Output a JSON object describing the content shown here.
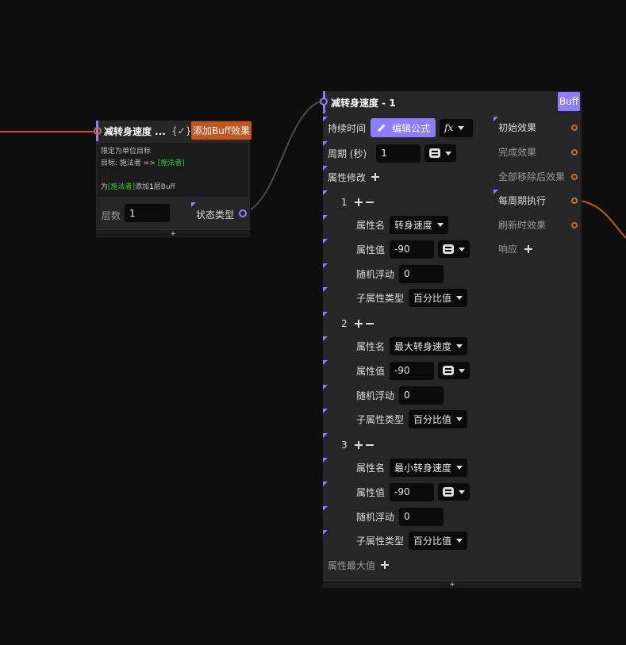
{
  "node_left": {
    "title": "减转身速度 ...",
    "check_label": "{✓}",
    "action_button": "添加Buff效果",
    "desc": {
      "line1": "限定为单位目标",
      "line2_prefix": "目标: 施法者 => ",
      "line2_link": "[施法者]",
      "line4_prefix": "为",
      "line4_link": "[施法者]",
      "line4_mid": "添加",
      "line4_count": "1",
      "line4_suffix": "层Buff"
    },
    "layers_label": "层数",
    "layers_value": "1",
    "state_type_label": "状态类型",
    "footer_plus": "+"
  },
  "node_main": {
    "title": "减转身速度 - 1",
    "badge": "Buff",
    "duration_label": "持续时间",
    "edit_formula_button": "编辑公式",
    "fx_icon": "fx",
    "period_label": "周期 (秒)",
    "period_value": "1",
    "attr_mod_label": "属性修改",
    "groups": [
      {
        "index": "1",
        "attr_name_label": "属性名",
        "attr_name_value": "转身速度",
        "attr_value_label": "属性值",
        "attr_value": "-90",
        "float_label": "随机浮动",
        "float_value": "0",
        "subtype_label": "子属性类型",
        "subtype_value": "百分比值"
      },
      {
        "index": "2",
        "attr_name_label": "属性名",
        "attr_name_value": "最大转身速度",
        "attr_value_label": "属性值",
        "attr_value": "-90",
        "float_label": "随机浮动",
        "float_value": "0",
        "subtype_label": "子属性类型",
        "subtype_value": "百分比值"
      },
      {
        "index": "3",
        "attr_name_label": "属性名",
        "attr_name_value": "最小转身速度",
        "attr_value_label": "属性值",
        "attr_value": "-90",
        "float_label": "随机浮动",
        "float_value": "0",
        "subtype_label": "子属性类型",
        "subtype_value": "百分比值"
      }
    ],
    "attr_max_label": "属性最大值",
    "outputs": {
      "initial": "初始效果",
      "complete": "完成效果",
      "after_remove_all": "全部移除后效果",
      "each_period": "每周期执行",
      "on_refresh": "刷新时效果",
      "response": "响应"
    },
    "footer_plus": "+"
  },
  "colors": {
    "accent": "#8e7cff",
    "orange_button": "#c4551f",
    "port_orange": "#d06a33",
    "link_green": "#2ecc40",
    "wire_gray": "#4a4a4a"
  }
}
